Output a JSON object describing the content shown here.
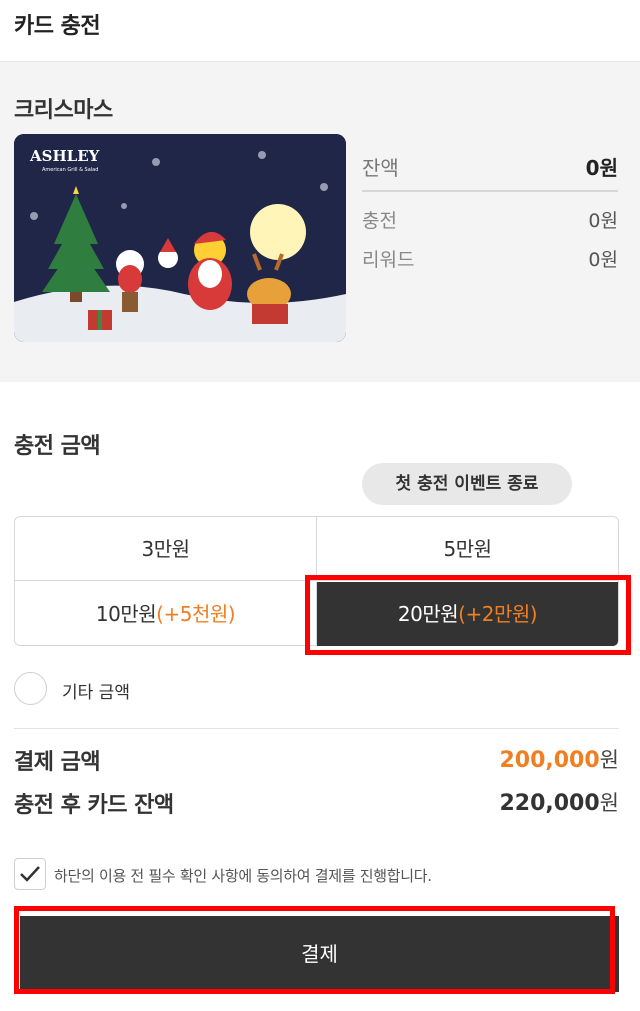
{
  "header": {
    "title": "카드 충전"
  },
  "card": {
    "name": "크리스마스",
    "brand": "ASHLEY",
    "brand_sub": "American Grill & Salad",
    "balance": [
      {
        "label": "잔액",
        "value": "0원"
      },
      {
        "label": "충전",
        "value": "0원"
      },
      {
        "label": "리워드",
        "value": "0원"
      }
    ]
  },
  "charge": {
    "title": "충전 금액",
    "event_badge": "첫 충전 이벤트 종료",
    "options": [
      {
        "amount": "3만원",
        "bonus": ""
      },
      {
        "amount": "5만원",
        "bonus": ""
      },
      {
        "amount": "10만원",
        "bonus": "(+5천원)"
      },
      {
        "amount": "20만원",
        "bonus": "(+2만원)",
        "selected": true
      }
    ],
    "other_label": "기타 금액"
  },
  "summary": {
    "payment_label": "결제 금액",
    "payment_value": "200,000",
    "payment_unit": "원",
    "after_label": "충전 후 카드 잔액",
    "after_value": "220,000",
    "after_unit": "원"
  },
  "agreement": {
    "label": "하단의 이용 전 필수 확인 사항에 동의하여 결제를 진행합니다.",
    "checked": true
  },
  "pay_button": {
    "label": "결제"
  },
  "colors": {
    "accent": "#f07f22",
    "dark": "#333333",
    "highlight": "#ff0000",
    "card_bg": "#1f2648"
  }
}
